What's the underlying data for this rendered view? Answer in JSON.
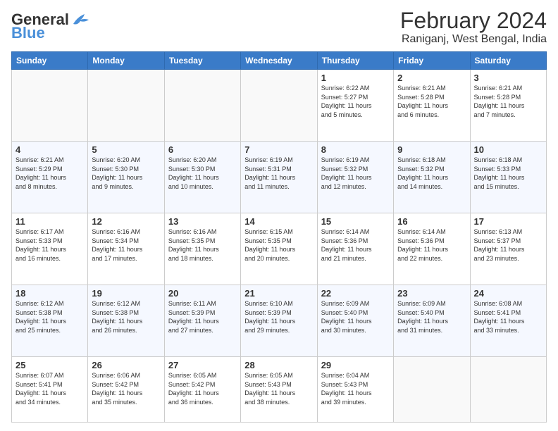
{
  "header": {
    "logo_general": "General",
    "logo_blue": "Blue",
    "title": "February 2024",
    "subtitle": "Raniganj, West Bengal, India"
  },
  "days_of_week": [
    "Sunday",
    "Monday",
    "Tuesday",
    "Wednesday",
    "Thursday",
    "Friday",
    "Saturday"
  ],
  "weeks": [
    [
      {
        "day": "",
        "sunrise": "",
        "sunset": "",
        "daylight": "",
        "empty": true
      },
      {
        "day": "",
        "sunrise": "",
        "sunset": "",
        "daylight": "",
        "empty": true
      },
      {
        "day": "",
        "sunrise": "",
        "sunset": "",
        "daylight": "",
        "empty": true
      },
      {
        "day": "",
        "sunrise": "",
        "sunset": "",
        "daylight": "",
        "empty": true
      },
      {
        "day": "1",
        "sunrise": "6:22 AM",
        "sunset": "5:27 PM",
        "daylight": "11 hours and 5 minutes."
      },
      {
        "day": "2",
        "sunrise": "6:21 AM",
        "sunset": "5:28 PM",
        "daylight": "11 hours and 6 minutes."
      },
      {
        "day": "3",
        "sunrise": "6:21 AM",
        "sunset": "5:28 PM",
        "daylight": "11 hours and 7 minutes."
      }
    ],
    [
      {
        "day": "4",
        "sunrise": "6:21 AM",
        "sunset": "5:29 PM",
        "daylight": "11 hours and 8 minutes."
      },
      {
        "day": "5",
        "sunrise": "6:20 AM",
        "sunset": "5:30 PM",
        "daylight": "11 hours and 9 minutes."
      },
      {
        "day": "6",
        "sunrise": "6:20 AM",
        "sunset": "5:30 PM",
        "daylight": "11 hours and 10 minutes."
      },
      {
        "day": "7",
        "sunrise": "6:19 AM",
        "sunset": "5:31 PM",
        "daylight": "11 hours and 11 minutes."
      },
      {
        "day": "8",
        "sunrise": "6:19 AM",
        "sunset": "5:32 PM",
        "daylight": "11 hours and 12 minutes."
      },
      {
        "day": "9",
        "sunrise": "6:18 AM",
        "sunset": "5:32 PM",
        "daylight": "11 hours and 14 minutes."
      },
      {
        "day": "10",
        "sunrise": "6:18 AM",
        "sunset": "5:33 PM",
        "daylight": "11 hours and 15 minutes."
      }
    ],
    [
      {
        "day": "11",
        "sunrise": "6:17 AM",
        "sunset": "5:33 PM",
        "daylight": "11 hours and 16 minutes."
      },
      {
        "day": "12",
        "sunrise": "6:16 AM",
        "sunset": "5:34 PM",
        "daylight": "11 hours and 17 minutes."
      },
      {
        "day": "13",
        "sunrise": "6:16 AM",
        "sunset": "5:35 PM",
        "daylight": "11 hours and 18 minutes."
      },
      {
        "day": "14",
        "sunrise": "6:15 AM",
        "sunset": "5:35 PM",
        "daylight": "11 hours and 20 minutes."
      },
      {
        "day": "15",
        "sunrise": "6:14 AM",
        "sunset": "5:36 PM",
        "daylight": "11 hours and 21 minutes."
      },
      {
        "day": "16",
        "sunrise": "6:14 AM",
        "sunset": "5:36 PM",
        "daylight": "11 hours and 22 minutes."
      },
      {
        "day": "17",
        "sunrise": "6:13 AM",
        "sunset": "5:37 PM",
        "daylight": "11 hours and 23 minutes."
      }
    ],
    [
      {
        "day": "18",
        "sunrise": "6:12 AM",
        "sunset": "5:38 PM",
        "daylight": "11 hours and 25 minutes."
      },
      {
        "day": "19",
        "sunrise": "6:12 AM",
        "sunset": "5:38 PM",
        "daylight": "11 hours and 26 minutes."
      },
      {
        "day": "20",
        "sunrise": "6:11 AM",
        "sunset": "5:39 PM",
        "daylight": "11 hours and 27 minutes."
      },
      {
        "day": "21",
        "sunrise": "6:10 AM",
        "sunset": "5:39 PM",
        "daylight": "11 hours and 29 minutes."
      },
      {
        "day": "22",
        "sunrise": "6:09 AM",
        "sunset": "5:40 PM",
        "daylight": "11 hours and 30 minutes."
      },
      {
        "day": "23",
        "sunrise": "6:09 AM",
        "sunset": "5:40 PM",
        "daylight": "11 hours and 31 minutes."
      },
      {
        "day": "24",
        "sunrise": "6:08 AM",
        "sunset": "5:41 PM",
        "daylight": "11 hours and 33 minutes."
      }
    ],
    [
      {
        "day": "25",
        "sunrise": "6:07 AM",
        "sunset": "5:41 PM",
        "daylight": "11 hours and 34 minutes."
      },
      {
        "day": "26",
        "sunrise": "6:06 AM",
        "sunset": "5:42 PM",
        "daylight": "11 hours and 35 minutes."
      },
      {
        "day": "27",
        "sunrise": "6:05 AM",
        "sunset": "5:42 PM",
        "daylight": "11 hours and 36 minutes."
      },
      {
        "day": "28",
        "sunrise": "6:05 AM",
        "sunset": "5:43 PM",
        "daylight": "11 hours and 38 minutes."
      },
      {
        "day": "29",
        "sunrise": "6:04 AM",
        "sunset": "5:43 PM",
        "daylight": "11 hours and 39 minutes."
      },
      {
        "day": "",
        "sunrise": "",
        "sunset": "",
        "daylight": "",
        "empty": true
      },
      {
        "day": "",
        "sunrise": "",
        "sunset": "",
        "daylight": "",
        "empty": true
      }
    ]
  ],
  "labels": {
    "sunrise": "Sunrise:",
    "sunset": "Sunset:",
    "daylight": "Daylight:"
  }
}
